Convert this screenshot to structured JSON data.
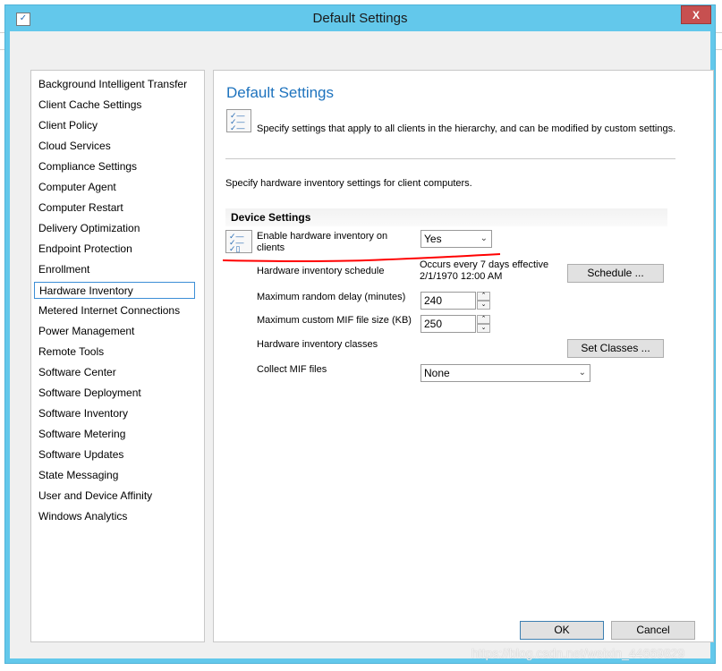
{
  "window": {
    "title": "Default Settings",
    "close_label": "X"
  },
  "sidebar": {
    "items": [
      {
        "label": "Background Intelligent Transfer"
      },
      {
        "label": "Client Cache Settings"
      },
      {
        "label": "Client Policy"
      },
      {
        "label": "Cloud Services"
      },
      {
        "label": "Compliance Settings"
      },
      {
        "label": "Computer Agent"
      },
      {
        "label": "Computer Restart"
      },
      {
        "label": "Delivery Optimization"
      },
      {
        "label": "Endpoint Protection"
      },
      {
        "label": "Enrollment"
      },
      {
        "label": "Hardware Inventory",
        "selected": true
      },
      {
        "label": "Metered Internet Connections"
      },
      {
        "label": "Power Management"
      },
      {
        "label": "Remote Tools"
      },
      {
        "label": "Software Center"
      },
      {
        "label": "Software Deployment"
      },
      {
        "label": "Software Inventory"
      },
      {
        "label": "Software Metering"
      },
      {
        "label": "Software Updates"
      },
      {
        "label": "State Messaging"
      },
      {
        "label": "User and Device Affinity"
      },
      {
        "label": "Windows Analytics"
      }
    ]
  },
  "main": {
    "heading": "Default Settings",
    "description": "Specify settings that apply to all clients in the hierarchy, and can be modified by custom settings.",
    "subtitle": "Specify hardware inventory settings for client computers.",
    "section": "Device Settings",
    "enable_label": "Enable hardware inventory on",
    "enable_label2": "clients",
    "enable_value": "Yes",
    "schedule_label": "Hardware inventory schedule",
    "schedule_text1": "Occurs every 7 days effective",
    "schedule_text2": "2/1/1970 12:00 AM",
    "schedule_button": "Schedule ...",
    "delay_label": "Maximum random delay (minutes)",
    "delay_value": "240",
    "mif_size_label": "Maximum custom MIF file size (KB)",
    "mif_size_value": "250",
    "classes_label": "Hardware inventory classes",
    "classes_button": "Set Classes ...",
    "collect_label": "Collect MIF files",
    "collect_value": "None"
  },
  "footer": {
    "ok": "OK",
    "cancel": "Cancel"
  },
  "watermark": "https://blog.csdn.net/weixin_44669829",
  "colors": {
    "titlebar": "#63c8eb",
    "heading": "#1e73be",
    "close": "#c75050",
    "annotation": "#ff0000"
  }
}
